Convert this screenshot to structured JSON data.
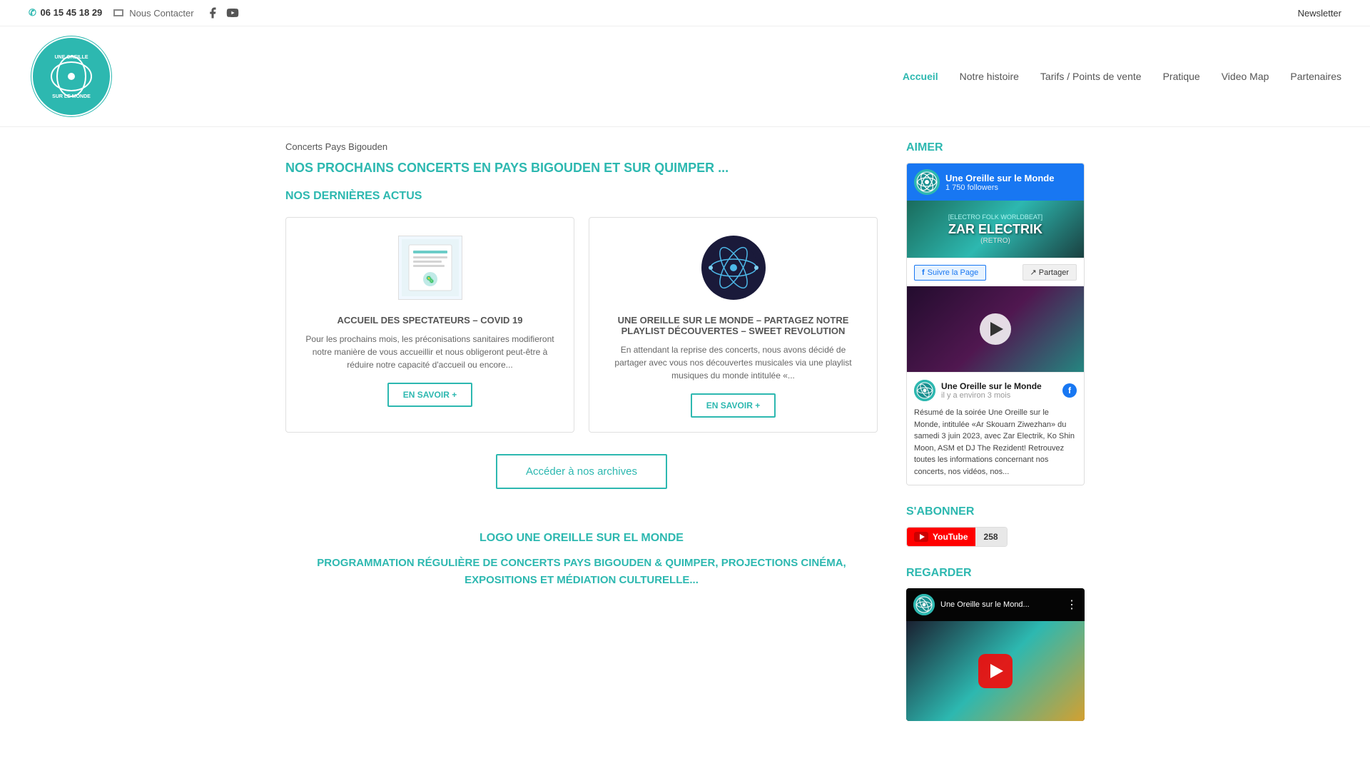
{
  "site": {
    "phone": "06 15 45 18 29",
    "contact_label": "Nous Contacter",
    "newsletter_label": "Newsletter"
  },
  "nav": {
    "logo_alt": "Une Oreille Sur Le Monde",
    "items": [
      {
        "label": "Accueil",
        "active": true
      },
      {
        "label": "Notre histoire",
        "active": false
      },
      {
        "label": "Tarifs / Points de vente",
        "active": false
      },
      {
        "label": "Pratique",
        "active": false
      },
      {
        "label": "Video Map",
        "active": false
      },
      {
        "label": "Partenaires",
        "active": false
      }
    ]
  },
  "content": {
    "breadcrumb": "Concerts Pays Bigouden",
    "main_title": "NOS PROCHAINS CONCERTS EN PAYS BIGOUDEN ET SUR QUIMPER ...",
    "news_title": "NOS DERNIÈRES ACTUS",
    "cards": [
      {
        "title": "ACCUEIL DES SPECTATEURS – COVID 19",
        "text": "Pour les prochains mois, les préconisations sanitaires modifieront notre manière de vous accueillir et nous obligeront peut-être à réduire notre capacité d'accueil ou encore...",
        "btn_label": "EN SAVOIR +"
      },
      {
        "title": "UNE OREILLE SUR LE MONDE – PARTAGEZ NOTRE PLAYLIST DÉCOUVERTES – SWEET REVOLUTION",
        "text": "En attendant la reprise des concerts, nous avons décidé de partager avec vous nos découvertes musicales via une playlist musiques du monde intitulée «...",
        "btn_label": "EN SAVOIR +"
      }
    ],
    "archive_btn": "Accéder à nos archives",
    "footer_logo_title": "LOGO UNE OREILLE SUR EL MONDE",
    "footer_promo": "PROGRAMMATION RÉGULIÈRE DE CONCERTS PAYS BIGOUDEN & QUIMPER,\nPROJECTIONS CINÉMA, EXPOSITIONS ET MÉDIATION CULTURELLE..."
  },
  "sidebar": {
    "aimer_title": "AIMER",
    "fb_page_name": "Une Oreille sur le Monde",
    "fb_followers": "1 750 followers",
    "fb_follow_btn": "Suivre la Page",
    "fb_share_btn": "Partager",
    "fb_band_label": "[ELECTRO FOLK WORLDBEAT]",
    "fb_band_name": "ZAR ELECTRIK",
    "fb_band_sub": "(RETRO)",
    "fb_post_name": "Une Oreille sur le Monde",
    "fb_post_time": "il y a environ 3 mois",
    "fb_post_text": "Résumé de la soirée Une Oreille sur le Monde, intitulée «Ar Skouarn Ziwezhan» du samedi 3 juin 2023, avec Zar Electrik, Ko Shin Moon, ASM et DJ The Rezident! Retrouvez toutes les informations concernant nos concerts, nos vidéos, nos...",
    "sabonner_title": "S'ABONNER",
    "yt_label": "YouTube",
    "yt_count": "258",
    "regarder_title": "REGARDER",
    "regarder_channel": "Une Oreille sur le Mond..."
  }
}
